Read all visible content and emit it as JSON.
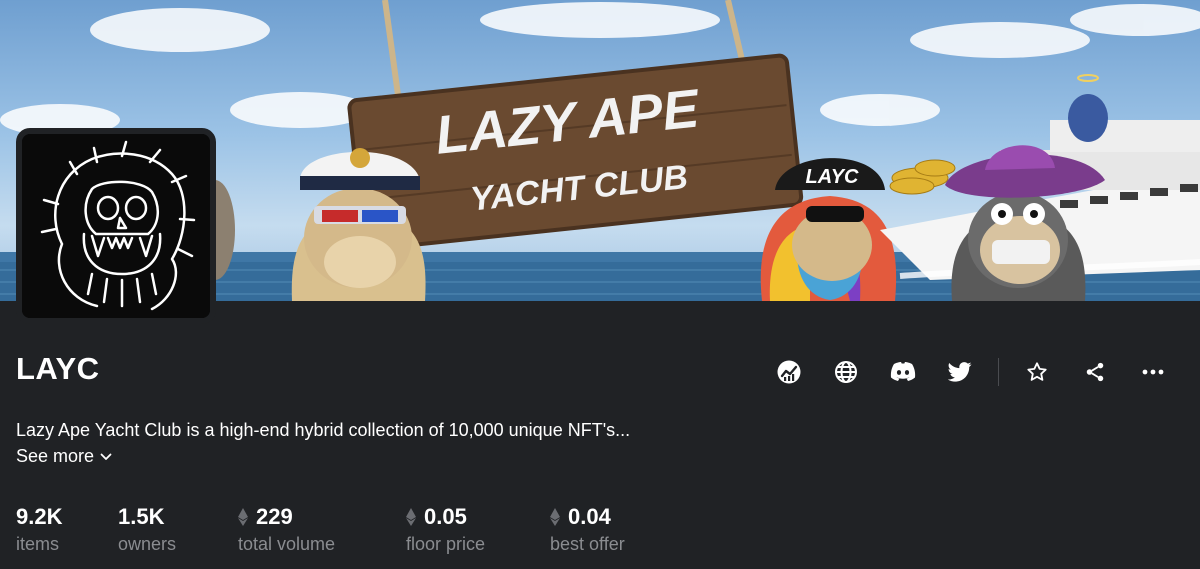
{
  "collection": {
    "name": "LAYC",
    "description": "Lazy Ape Yacht Club is a high-end hybrid collection of 10,000 unique NFT's...",
    "see_more": "See more",
    "banner_sign_line1": "LAZY APE",
    "banner_sign_line2": "YACHT CLUB",
    "banner_cap_text": "LAYC"
  },
  "actions": [
    {
      "icon": "activity-chart-icon"
    },
    {
      "icon": "globe-icon"
    },
    {
      "icon": "discord-icon"
    },
    {
      "icon": "twitter-icon"
    },
    {
      "icon": "star-icon"
    },
    {
      "icon": "share-icon"
    },
    {
      "icon": "more-icon"
    }
  ],
  "stats": {
    "items": {
      "value": "9.2K",
      "label": "items"
    },
    "owners": {
      "value": "1.5K",
      "label": "owners"
    },
    "total_volume": {
      "value": "229",
      "label": "total volume"
    },
    "floor_price": {
      "value": "0.05",
      "label": "floor price"
    },
    "best_offer": {
      "value": "0.04",
      "label": "best offer"
    }
  },
  "colors": {
    "background": "#202225",
    "muted_text": "#8a8c90",
    "text": "#ffffff"
  }
}
